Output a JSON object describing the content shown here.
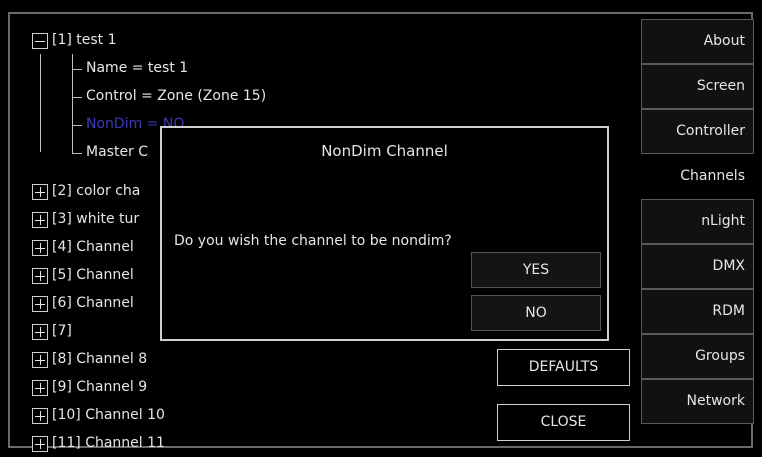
{
  "tree": {
    "items": [
      {
        "label": "[1] test 1"
      },
      {
        "label": "Name = test 1"
      },
      {
        "label": "Control = Zone (Zone 15)"
      },
      {
        "label": "NonDim = NO"
      },
      {
        "label": "Master C"
      },
      {
        "label": "[2] color cha"
      },
      {
        "label": "[3] white tur"
      },
      {
        "label": "[4] Channel"
      },
      {
        "label": "[5] Channel"
      },
      {
        "label": "[6] Channel"
      },
      {
        "label": "[7]"
      },
      {
        "label": "[8] Channel 8"
      },
      {
        "label": "[9] Channel 9"
      },
      {
        "label": "[10] Channel 10"
      },
      {
        "label": "[11] Channel 11"
      }
    ]
  },
  "tabs": [
    "About",
    "Screen",
    "Controller",
    "Channels",
    "nLight",
    "DMX",
    "RDM",
    "Groups",
    "Network"
  ],
  "active_tab": "Channels",
  "buttons": {
    "defaults": "DEFAULTS",
    "close": "CLOSE"
  },
  "dialog": {
    "title": "NonDim Channel",
    "message": "Do you wish the channel to be nondim?",
    "yes": "YES",
    "no": "NO"
  },
  "colors": {
    "dim_row": "#3a3ab8",
    "border": "#cfcfcf",
    "background": "#000000"
  }
}
